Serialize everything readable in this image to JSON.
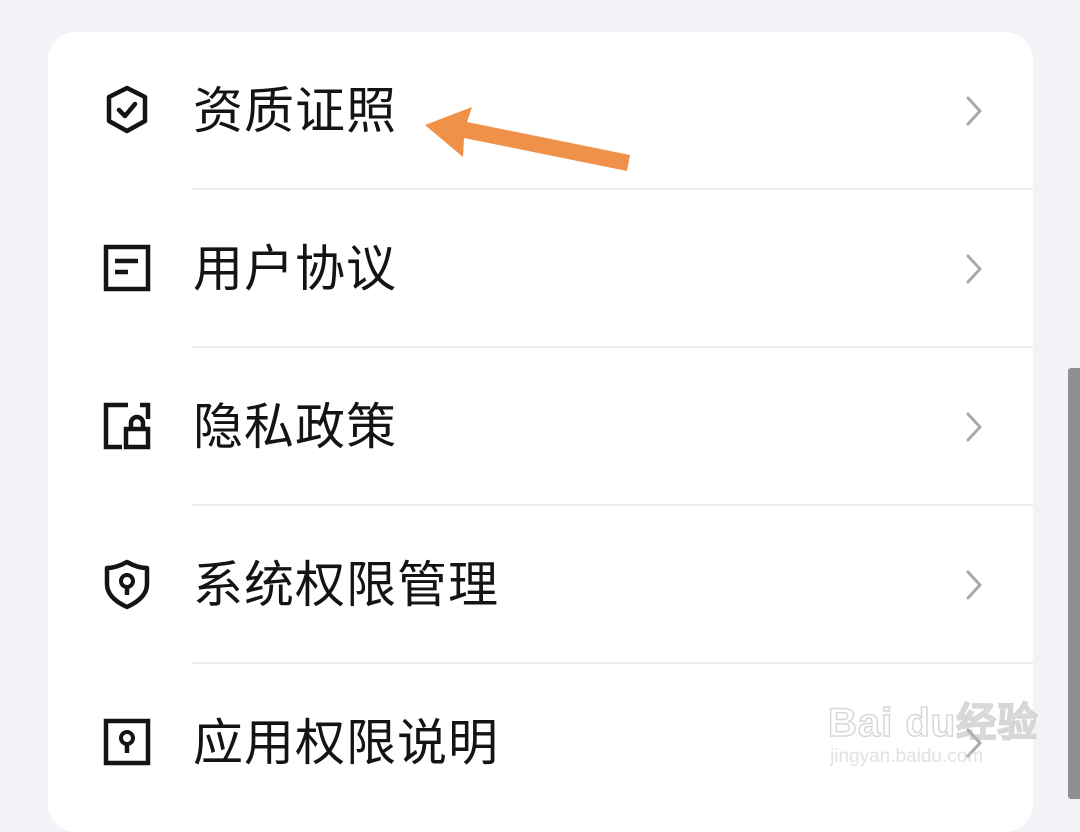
{
  "menu": {
    "items": [
      {
        "label": "资质证照",
        "icon": "shield-check-icon"
      },
      {
        "label": "用户协议",
        "icon": "document-icon"
      },
      {
        "label": "隐私政策",
        "icon": "privacy-lock-icon"
      },
      {
        "label": "系统权限管理",
        "icon": "shield-keyhole-icon"
      },
      {
        "label": "应用权限说明",
        "icon": "keyhole-icon"
      }
    ],
    "chevron_icon": "chevron-right-icon"
  },
  "annotation": {
    "arrow_color": "#f0914a",
    "arrow_icon": "arrow-left-icon"
  },
  "watermark": {
    "brand": "Bai du经验",
    "url": "jingyan.baidu.com"
  },
  "colors": {
    "background": "#f3f3f7",
    "card": "#ffffff",
    "text": "#141414",
    "chevron": "#a8a8ad",
    "divider": "#ececf0"
  }
}
